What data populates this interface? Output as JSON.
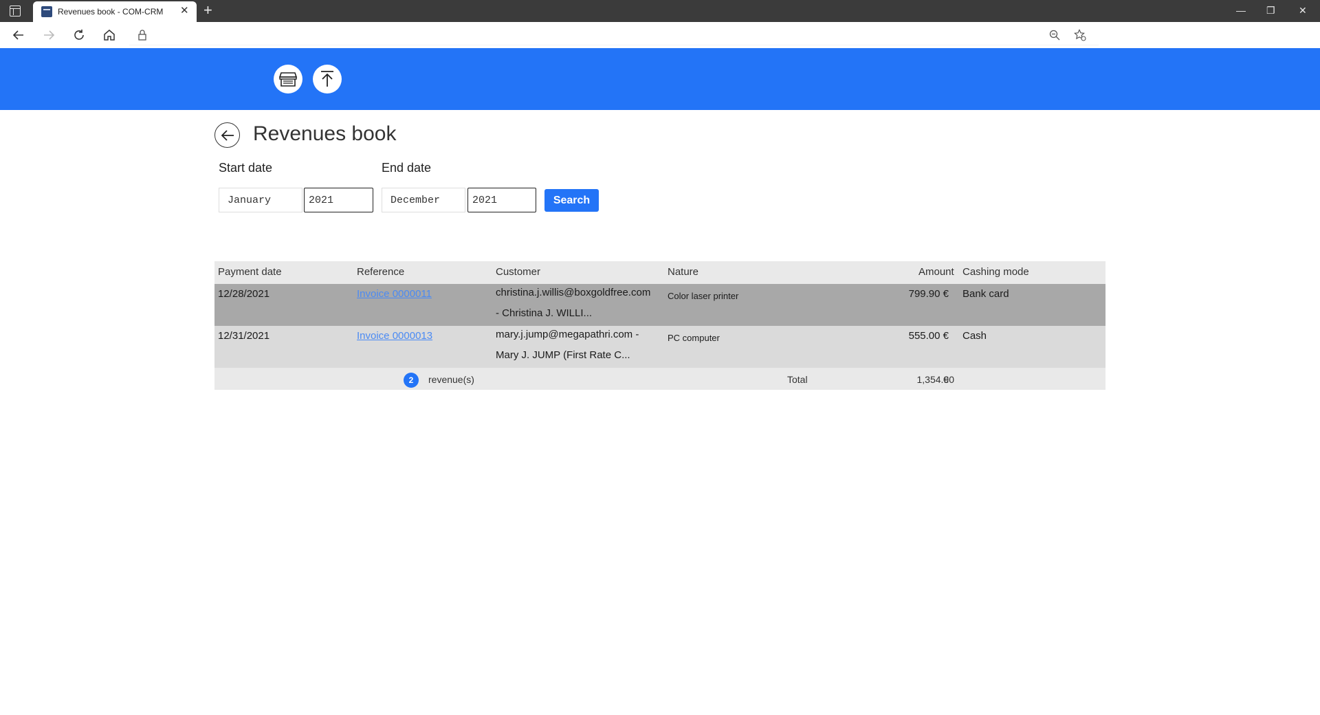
{
  "browser": {
    "tab_title": "Revenues book - COM-CRM",
    "new_tab": "+",
    "tab_close": "✕",
    "minimize": "—",
    "restore": "❐",
    "close": "✕"
  },
  "page": {
    "title": "Revenues book",
    "start_label": "Start date",
    "end_label": "End date",
    "start_month": "January",
    "start_year": "2021",
    "end_month": "December",
    "end_year": "2021",
    "search_label": "Search"
  },
  "table": {
    "headers": {
      "payment_date": "Payment date",
      "reference": "Reference",
      "customer": "Customer",
      "nature": "Nature",
      "amount": "Amount",
      "cashing_mode": "Cashing mode"
    },
    "rows": [
      {
        "payment_date": "12/28/2021",
        "reference": "Invoice 0000011",
        "customer_line1": "christina.j.willis@boxgoldfree.com",
        "customer_line2": "- Christina J. WILLI...",
        "nature": "Color laser printer",
        "amount": "799.90 €",
        "cashing_mode": "Bank card"
      },
      {
        "payment_date": "12/31/2021",
        "reference": "Invoice 0000013",
        "customer_line1": "mary.j.jump@megapathri.com -",
        "customer_line2": "Mary J. JUMP (First Rate C...",
        "nature": "PC computer",
        "amount": "555.00 €",
        "cashing_mode": "Cash"
      }
    ],
    "footer": {
      "count": "2",
      "count_label": "revenue(s)",
      "total_label": "Total",
      "total_value": "1,354.90",
      "currency": "€"
    }
  },
  "colors": {
    "brand": "#2374f7",
    "row_selected": "#a8a8a8",
    "row_alt": "#dadada"
  }
}
